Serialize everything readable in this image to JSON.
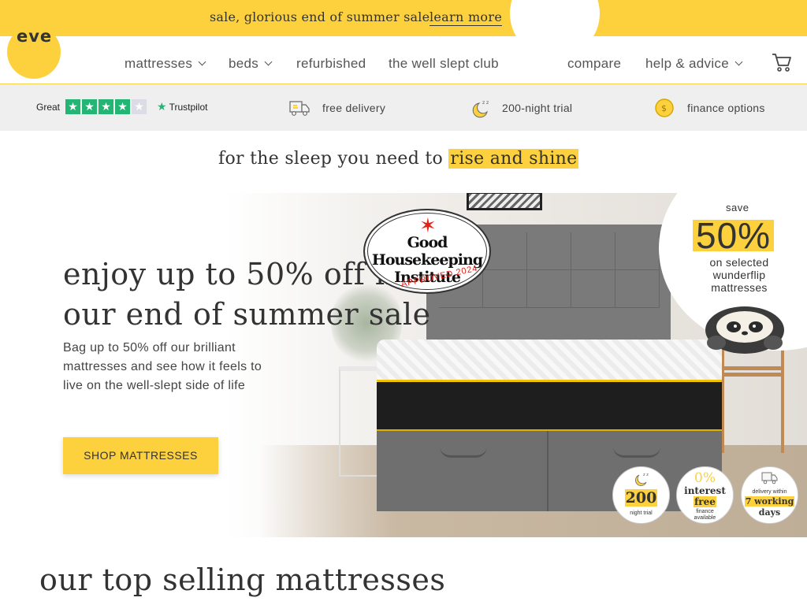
{
  "promo": {
    "text": "sale, glorious end of summer sale",
    "link": "learn more"
  },
  "brand": {
    "logo_text": "eve",
    "accent": "#fcd13d"
  },
  "nav": {
    "items": [
      {
        "label": "mattresses",
        "dropdown": true
      },
      {
        "label": "beds",
        "dropdown": true
      },
      {
        "label": "refurbished",
        "dropdown": false
      },
      {
        "label": "the well slept club",
        "dropdown": false
      }
    ],
    "right": [
      {
        "label": "compare",
        "dropdown": false
      },
      {
        "label": "help & advice",
        "dropdown": true
      }
    ],
    "cart_icon": "cart-icon"
  },
  "trust": {
    "trustpilot": {
      "rating_label": "Great",
      "stars": 4,
      "brand": "Trustpilot"
    },
    "usps": [
      {
        "icon": "truck-icon",
        "label": "free delivery"
      },
      {
        "icon": "moon-icon",
        "label": "200-night trial"
      },
      {
        "icon": "coin-icon",
        "label": "finance options"
      }
    ]
  },
  "tagline": {
    "lead": "for the sleep you need to",
    "highlight": "rise and shine"
  },
  "hero": {
    "title_line1": "enjoy up to 50% off in",
    "title_line2": "our end of summer sale",
    "body": "Bag up to 50% off our brilliant mattresses and see how it feels to live on the well-slept side of life",
    "cta": "SHOP MATTRESSES",
    "award": {
      "name_line1": "Good Housekeeping",
      "name_line2": "Institute",
      "approved": "APPROVED 2024"
    },
    "save": {
      "label": "save",
      "value": "50%",
      "sub_line1": "on selected",
      "sub_line2": "wunderflip",
      "sub_line3": "mattresses"
    },
    "badges": [
      {
        "big": "200",
        "small": "night trial",
        "icon": "moon-icon"
      },
      {
        "top": "0%",
        "big": "interest",
        "highlight": "free",
        "small": "finance available"
      },
      {
        "top": "delivery within",
        "highlight": "7 working",
        "big": "days",
        "icon": "truck-icon"
      }
    ]
  },
  "section": {
    "title": "our top selling mattresses"
  }
}
